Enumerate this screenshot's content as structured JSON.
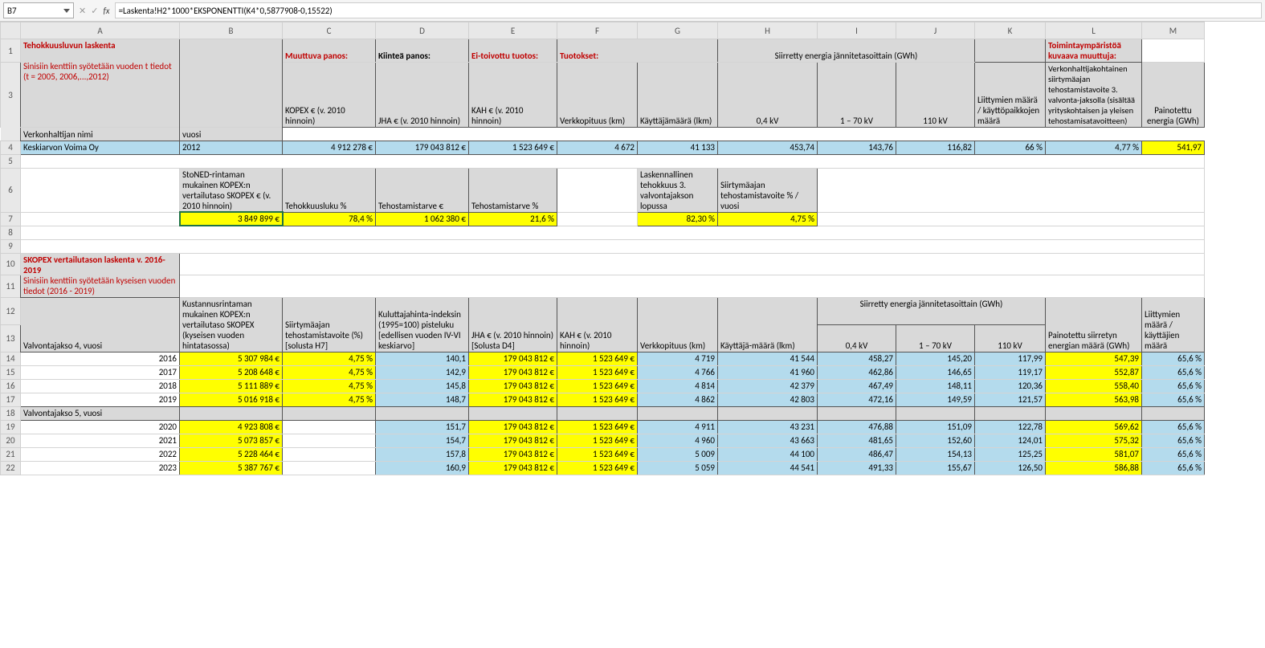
{
  "cellRef": "B7",
  "formula": "=Laskenta!H2*1000*EKSPONENTTI(K4*0,5877908-0,15522)",
  "cols": [
    "A",
    "B",
    "C",
    "D",
    "E",
    "F",
    "G",
    "H",
    "I",
    "J",
    "K",
    "L",
    "M"
  ],
  "r1A": "Tehokkuusluvun laskenta",
  "r1A2": "Sinisiin kenttiin syötetään vuoden t tiedot (t = 2005, 2006,...,2012)",
  "r1C": "Muuttuva panos:",
  "r1D": "Kiinteä panos:",
  "r1E": "Ei-toivottu tuotos:",
  "r1F": "Tuotokset:",
  "r1H": "Siirretty energia jännitetasoittain (GWh)",
  "r1L": "Toimintaympäristöä kuvaava muuttuja:",
  "r3A": "Verkonhaltijan nimi",
  "r3B": "vuosi",
  "r3C": "KOPEX € (v. 2010 hinnoin)",
  "r3D": "JHA € (v. 2010 hinnoin)",
  "r3E": "KAH € (v. 2010 hinnoin)",
  "r3F": "Verkkopituus (km)",
  "r3G": "Käyttäjämäärä (lkm)",
  "r3H": "0,4 kV",
  "r3I": "1 – 70 kV",
  "r3J": "110 kV",
  "r3K": "Liittymien määrä / käyttöpaikkojen määrä",
  "r3L": "Verkonhaltijakohtainen siirtymäajan tehostamistavoite 3. valvonta-jaksolla (sisältää yrityskohtaisen ja yleisen tehostamisatavoitteen)",
  "r3M": "Painotettu energia (GWh)",
  "r4A": "Keskiarvon Voima Oy",
  "r4B": "2012",
  "r4C": "4 912 278 €",
  "r4D": "179 043 812 €",
  "r4E": "1 523 649 €",
  "r4F": "4 672",
  "r4G": "41 133",
  "r4H": "453,74",
  "r4I": "143,76",
  "r4J": "116,82",
  "r4K": "66 %",
  "r4L": "4,77 %",
  "r4M": "541,97",
  "r6B": "StoNED-rintaman mukainen KOPEX:n vertailutaso SKOPEX € (v. 2010 hinnoin)",
  "r6C": "Tehokkuusluku %",
  "r6D": "Tehostamistarve €",
  "r6E": "Tehostamistarve %",
  "r6G": "Laskennallinen tehokkuus 3. valvontajakson lopussa",
  "r6H": "Siirtymäajan tehostamistavoite % / vuosi",
  "r7B": "3 849 899 €",
  "r7C": "78,4 %",
  "r7D": "1 062 380 €",
  "r7E": "21,6 %",
  "r7G": "82,30 %",
  "r7H": "4,75 %",
  "r10A": "SKOPEX vertailutason laskenta v. 2016-2019",
  "r11A": "Sinisiin kenttiin syötetään kyseisen vuoden tiedot (2016 - 2019)",
  "r12H": "Siirretty energia jännitetasoittain (GWh)",
  "r13A": "Valvontajakso 4,   vuosi",
  "r13B": "Kustannusrintaman mukainen KOPEX:n vertailutaso SKOPEX (kyseisen vuoden hintatasossa)",
  "r13C": "Siirtymäajan tehostamistavoite (%) [solusta H7]",
  "r13D": "Kuluttajahinta-indeksin (1995=100) pisteluku [edellisen vuoden IV-VI keskiarvo]",
  "r13E": "JHA € (v. 2010 hinnoin) [Solusta D4]",
  "r13F": "KAH € (v. 2010 hinnoin)",
  "r13G": "Verkkopituus (km)",
  "r13H2": "Käyttäjä-määrä (lkm)",
  "r13I": "0,4 kV",
  "r13J": "1 – 70 kV",
  "r13K": "110 kV",
  "r13L": "Painotettu siirretyn energian määrä (GWh)",
  "r13M": "Liittymien määrä / käyttäjien määrä",
  "r14A": "2016",
  "r14B": "5 307 984 €",
  "r14C": "4,75 %",
  "r14D": "140,1",
  "r14E": "179 043 812 €",
  "r14F": "1 523 649 €",
  "r14G": "4 719",
  "r14H": "41 544",
  "r14I": "458,27",
  "r14J": "145,20",
  "r14K": "117,99",
  "r14L": "547,39",
  "r14M": "65,6 %",
  "r15A": "2017",
  "r15B": "5 208 648 €",
  "r15C": "4,75 %",
  "r15D": "142,9",
  "r15E": "179 043 812 €",
  "r15F": "1 523 649 €",
  "r15G": "4 766",
  "r15H": "41 960",
  "r15I": "462,86",
  "r15J": "146,65",
  "r15K": "119,17",
  "r15L": "552,87",
  "r15M": "65,6 %",
  "r16A": "2018",
  "r16B": "5 111 889 €",
  "r16C": "4,75 %",
  "r16D": "145,8",
  "r16E": "179 043 812 €",
  "r16F": "1 523 649 €",
  "r16G": "4 814",
  "r16H": "42 379",
  "r16I": "467,49",
  "r16J": "148,11",
  "r16K": "120,36",
  "r16L": "558,40",
  "r16M": "65,6 %",
  "r17A": "2019",
  "r17B": "5 016 918 €",
  "r17C": "4,75 %",
  "r17D": "148,7",
  "r17E": "179 043 812 €",
  "r17F": "1 523 649 €",
  "r17G": "4 862",
  "r17H": "42 803",
  "r17I": "472,16",
  "r17J": "149,59",
  "r17K": "121,57",
  "r17L": "563,98",
  "r17M": "65,6 %",
  "r18A": "Valvontajakso 5,   vuosi",
  "r19A": "2020",
  "r19B": "4 923 808 €",
  "r19D": "151,7",
  "r19E": "179 043 812 €",
  "r19F": "1 523 649 €",
  "r19G": "4 911",
  "r19H": "43 231",
  "r19I": "476,88",
  "r19J": "151,09",
  "r19K": "122,78",
  "r19L": "569,62",
  "r19M": "65,6 %",
  "r20A": "2021",
  "r20B": "5 073 857 €",
  "r20D": "154,7",
  "r20E": "179 043 812 €",
  "r20F": "1 523 649 €",
  "r20G": "4 960",
  "r20H": "43 663",
  "r20I": "481,65",
  "r20J": "152,60",
  "r20K": "124,01",
  "r20L": "575,32",
  "r20M": "65,6 %",
  "r21A": "2022",
  "r21B": "5 228 464 €",
  "r21D": "157,8",
  "r21E": "179 043 812 €",
  "r21F": "1 523 649 €",
  "r21G": "5 009",
  "r21H": "44 100",
  "r21I": "486,47",
  "r21J": "154,13",
  "r21K": "125,25",
  "r21L": "581,07",
  "r21M": "65,6 %",
  "r22A": "2023",
  "r22B": "5 387 767 €",
  "r22D": "160,9",
  "r22E": "179 043 812 €",
  "r22F": "1 523 649 €",
  "r22G": "5 059",
  "r22H": "44 541",
  "r22I": "491,33",
  "r22J": "155,67",
  "r22K": "126,50",
  "r22L": "586,88",
  "r22M": "65,6 %"
}
